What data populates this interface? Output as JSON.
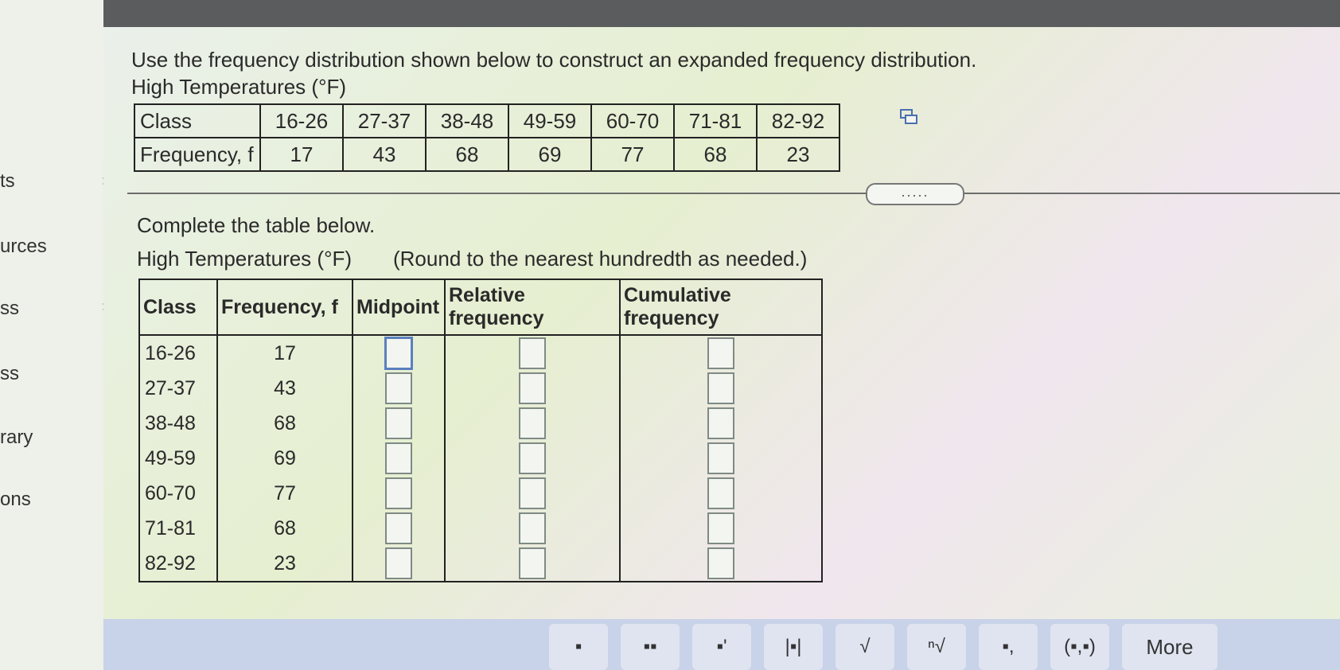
{
  "sidebar": {
    "items": [
      "ts",
      "urces",
      "ss",
      "ss",
      "rary",
      "ons"
    ]
  },
  "question": {
    "intro": "Use the frequency distribution shown below to construct an expanded frequency distribution.",
    "given_caption": "High Temperatures (°F)",
    "given_table": {
      "row_label_class": "Class",
      "row_label_freq": "Frequency, f",
      "classes": [
        "16-26",
        "27-37",
        "38-48",
        "49-59",
        "60-70",
        "71-81",
        "82-92"
      ],
      "frequencies": [
        "17",
        "43",
        "68",
        "69",
        "77",
        "68",
        "23"
      ]
    },
    "expand_label": "....."
  },
  "task": {
    "instruction": "Complete the table below.",
    "caption": "High Temperatures (°F)",
    "round_note": "(Round to the nearest hundredth as needed.)",
    "headers": {
      "class": "Class",
      "frequency": "Frequency, f",
      "midpoint": "Midpoint",
      "relative": "Relative frequency",
      "cumulative": "Cumulative frequency"
    },
    "rows": [
      {
        "class": "16-26",
        "freq": "17"
      },
      {
        "class": "27-37",
        "freq": "43"
      },
      {
        "class": "38-48",
        "freq": "68"
      },
      {
        "class": "49-59",
        "freq": "69"
      },
      {
        "class": "60-70",
        "freq": "77"
      },
      {
        "class": "71-81",
        "freq": "68"
      },
      {
        "class": "82-92",
        "freq": "23"
      }
    ]
  },
  "toolbar": {
    "more_label": "More"
  },
  "colors": {
    "accent_box": "#5b7fbf",
    "topbar": "#5a5c5e"
  }
}
